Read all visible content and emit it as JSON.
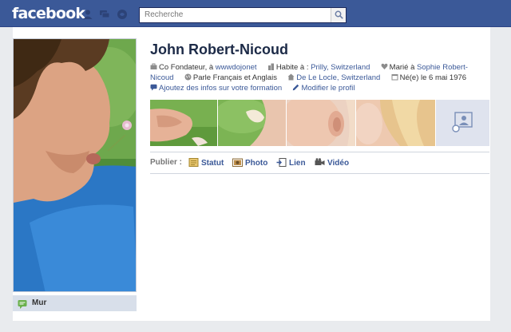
{
  "topbar": {
    "logo": "facebook",
    "jewels": [
      "friend-requests-icon",
      "messages-icon",
      "notifications-icon"
    ],
    "search": {
      "placeholder": "Recherche"
    }
  },
  "profile": {
    "name": "John Robert-Nicoud",
    "info": {
      "work_prefix": "Co Fondateur, à",
      "work_link": "wwwdojonet",
      "lives_prefix": "Habite à :",
      "lives_link": "Prilly, Switzerland",
      "married_prefix": "Marié à",
      "married_link": "Sophie Robert-Nicoud",
      "languages": "Parle Français et Anglais",
      "from_link": "De Le Locle, Switzerland",
      "born": "Né(e) le 6 mai 1976",
      "add_education": "Ajoutez des infos sur votre formation",
      "edit_profile": "Modifier le profil"
    }
  },
  "publisher": {
    "label": "Publier :",
    "items": [
      "Statut",
      "Photo",
      "Lien",
      "Vidéo"
    ]
  },
  "leftnav": {
    "items": [
      "Mur"
    ]
  },
  "colors": {
    "brand": "#3b5998",
    "link": "#3b5998",
    "name": "#1c2a47",
    "nav_active": "#d8dfea"
  }
}
